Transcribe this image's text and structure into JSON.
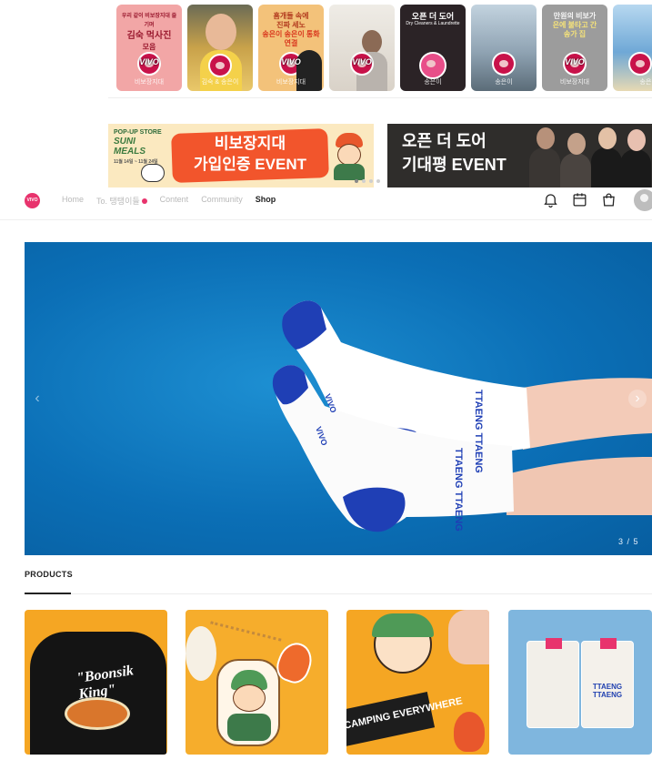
{
  "thumbnails": [
    {
      "lines": [
        "우리 같이 비보장지대 즐기며",
        "김숙 먹사진",
        "모음"
      ],
      "logo": "VIVO",
      "name": "비보장지대",
      "bg": "#f2a6a6",
      "capColor": "#9b1b30"
    },
    {
      "lines": [],
      "logo": "",
      "name": "김숙 & 송은이",
      "bg": "#c9a24a",
      "capColor": "#ffffff"
    },
    {
      "lines": [
        "홈개들 속에",
        "진짜 세노",
        "송은이 송은이 통화연결"
      ],
      "logo": "VIVO",
      "name": "비보장지대",
      "bg": "#f3c27a",
      "capColor": "#b23a1e"
    },
    {
      "lines": [],
      "logo": "VIVO",
      "name": "",
      "bg": "#d9d2c8",
      "capColor": "#ffffff"
    },
    {
      "lines": [
        "오픈 더 도어",
        "Dry Cleaners & Laundrette"
      ],
      "logo": "",
      "name": "송은이",
      "bg": "#2b2326",
      "capColor": "#ffffff"
    },
    {
      "lines": [],
      "logo": "",
      "name": "송은이",
      "bg": "#8fa3b3",
      "capColor": "#ffffff"
    },
    {
      "lines": [
        "만원의 비보가",
        "은에 불타고 간",
        "송가 집"
      ],
      "logo": "VIVO",
      "name": "비보장지대",
      "bg": "#9c9c9c",
      "capColor": "#f5e27a"
    },
    {
      "lines": [],
      "logo": "",
      "name": "송은",
      "bg": "#6fa8d6",
      "capColor": "#ffffff"
    }
  ],
  "banners": {
    "left": {
      "side_small": "POP-UP STORE",
      "side_big": "SUNI MEALS",
      "side_dates": "11월 14일 ~ 11월 24일",
      "line1": "비보장지대",
      "line2": "가입인증 EVENT"
    },
    "right": {
      "line1": "오픈 더 도어",
      "line2": "기대평 EVENT"
    }
  },
  "nav": {
    "logo": "VIVO",
    "links": {
      "home": "Home",
      "to": "To. 탱탱이들",
      "content": "Content",
      "community": "Community",
      "shop": "Shop"
    }
  },
  "hero": {
    "counter": "3 / 5",
    "sock_text": "TTAENG TTAENG",
    "sock_brand": "VIVO"
  },
  "products": {
    "title": "PRODUCTS",
    "items": [
      {
        "label": "\"Boonsik King\"",
        "bg": "#f5a623"
      },
      {
        "label": "",
        "bg": "#f6ad2c"
      },
      {
        "label": "CAMPING EVERYWHERE",
        "bg": "#f5a623"
      },
      {
        "label": "TTAENG TTAENG",
        "bg": "#7fb6de"
      }
    ]
  },
  "colors": {
    "brand": "#e8336d",
    "hero_blue": "#0b6fb6",
    "sock_blue": "#1f3fb5"
  }
}
